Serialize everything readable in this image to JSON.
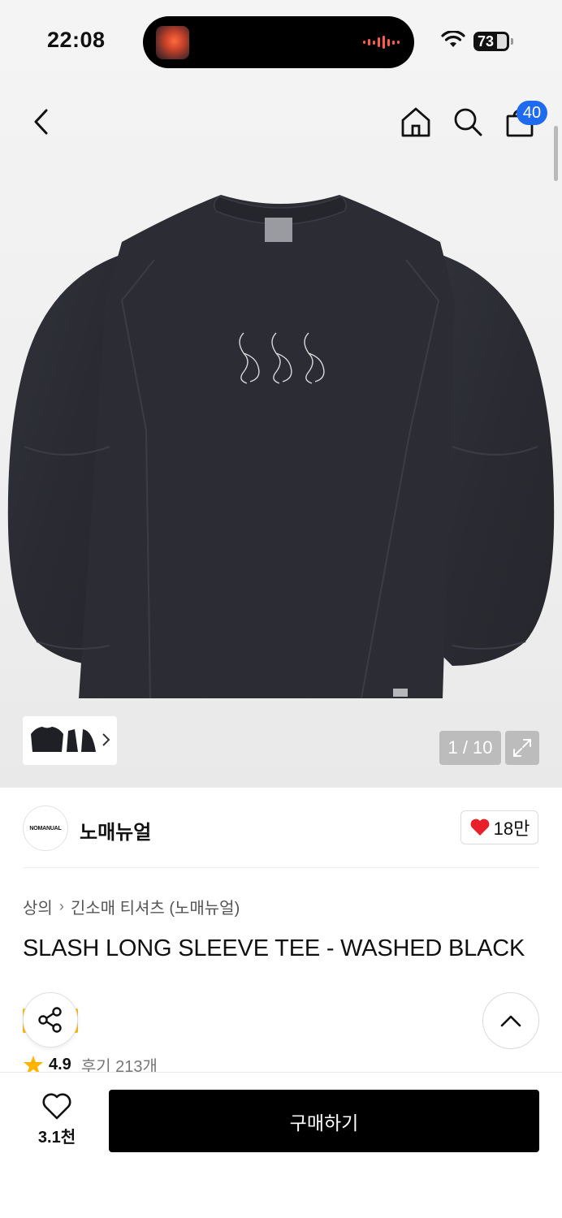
{
  "status_bar": {
    "time": "22:08",
    "battery": "73"
  },
  "header": {
    "cart_badge": "40"
  },
  "gallery": {
    "page_counter": "1 / 10"
  },
  "brand": {
    "logo_text": "NOMANUAL",
    "name": "노매뉴얼",
    "like_count": "18만"
  },
  "breadcrumb": {
    "category": "상의",
    "subcategory": "긴소매 티셔츠 (노매뉴얼)"
  },
  "product": {
    "title": "SLASH LONG SLEEVE TEE - WASHED BLACK",
    "promo_badge": "일",
    "rating": "4.9",
    "review_text": "후기 213개"
  },
  "bottom_bar": {
    "wish_count": "3.1천",
    "buy_label": "구매하기"
  },
  "colors": {
    "accent_blue": "#1e6bf0",
    "heart_red": "#e8202a",
    "promo_yellow": "#ffb400",
    "star": "#ffb400",
    "shirt": "#2b2c33"
  },
  "icons": [
    "chevron-left-icon",
    "home-icon",
    "search-icon",
    "cart-icon",
    "wifi-icon",
    "expand-icon",
    "heart-icon",
    "share-icon",
    "chevron-up-icon",
    "star-icon",
    "chevron-right-icon"
  ]
}
